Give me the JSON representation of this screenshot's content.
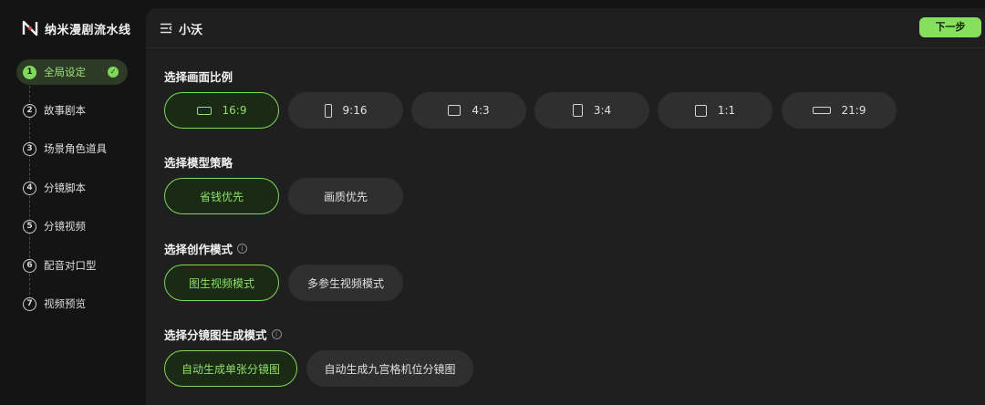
{
  "brand": {
    "name": "纳米漫剧流水线",
    "logo_icon": "nano-logo-icon"
  },
  "steps": [
    {
      "num": "1",
      "label": "全局设定",
      "active": true,
      "done": true
    },
    {
      "num": "2",
      "label": "故事剧本"
    },
    {
      "num": "3",
      "label": "场景角色道具"
    },
    {
      "num": "4",
      "label": "分镜脚本"
    },
    {
      "num": "5",
      "label": "分镜视频"
    },
    {
      "num": "6",
      "label": "配音对口型"
    },
    {
      "num": "7",
      "label": "视频预览"
    }
  ],
  "header": {
    "project_name": "小沃",
    "next_label": "下一步"
  },
  "aspect": {
    "title": "选择画面比例",
    "options": [
      {
        "label": "16:9",
        "icon": "ratio-16-9-icon",
        "selected": true
      },
      {
        "label": "9:16",
        "icon": "ratio-9-16-icon"
      },
      {
        "label": "4:3",
        "icon": "ratio-4-3-icon"
      },
      {
        "label": "3:4",
        "icon": "ratio-3-4-icon"
      },
      {
        "label": "1:1",
        "icon": "ratio-1-1-icon"
      },
      {
        "label": "21:9",
        "icon": "ratio-21-9-icon"
      }
    ]
  },
  "strategy": {
    "title": "选择模型策略",
    "options": [
      {
        "label": "省钱优先",
        "selected": true
      },
      {
        "label": "画质优先"
      }
    ]
  },
  "creation": {
    "title": "选择创作模式",
    "info_icon": "info-icon",
    "options": [
      {
        "label": "图生视频模式",
        "selected": true
      },
      {
        "label": "多参生视频模式"
      }
    ]
  },
  "storyboard": {
    "title": "选择分镜图生成模式",
    "info_icon": "info-icon",
    "options": [
      {
        "label": "自动生成单张分镜图",
        "selected": true
      },
      {
        "label": "自动生成九宫格机位分镜图"
      }
    ]
  },
  "colors": {
    "accent": "#7fd85a",
    "panel": "#1f1f1f",
    "background": "#141414"
  }
}
